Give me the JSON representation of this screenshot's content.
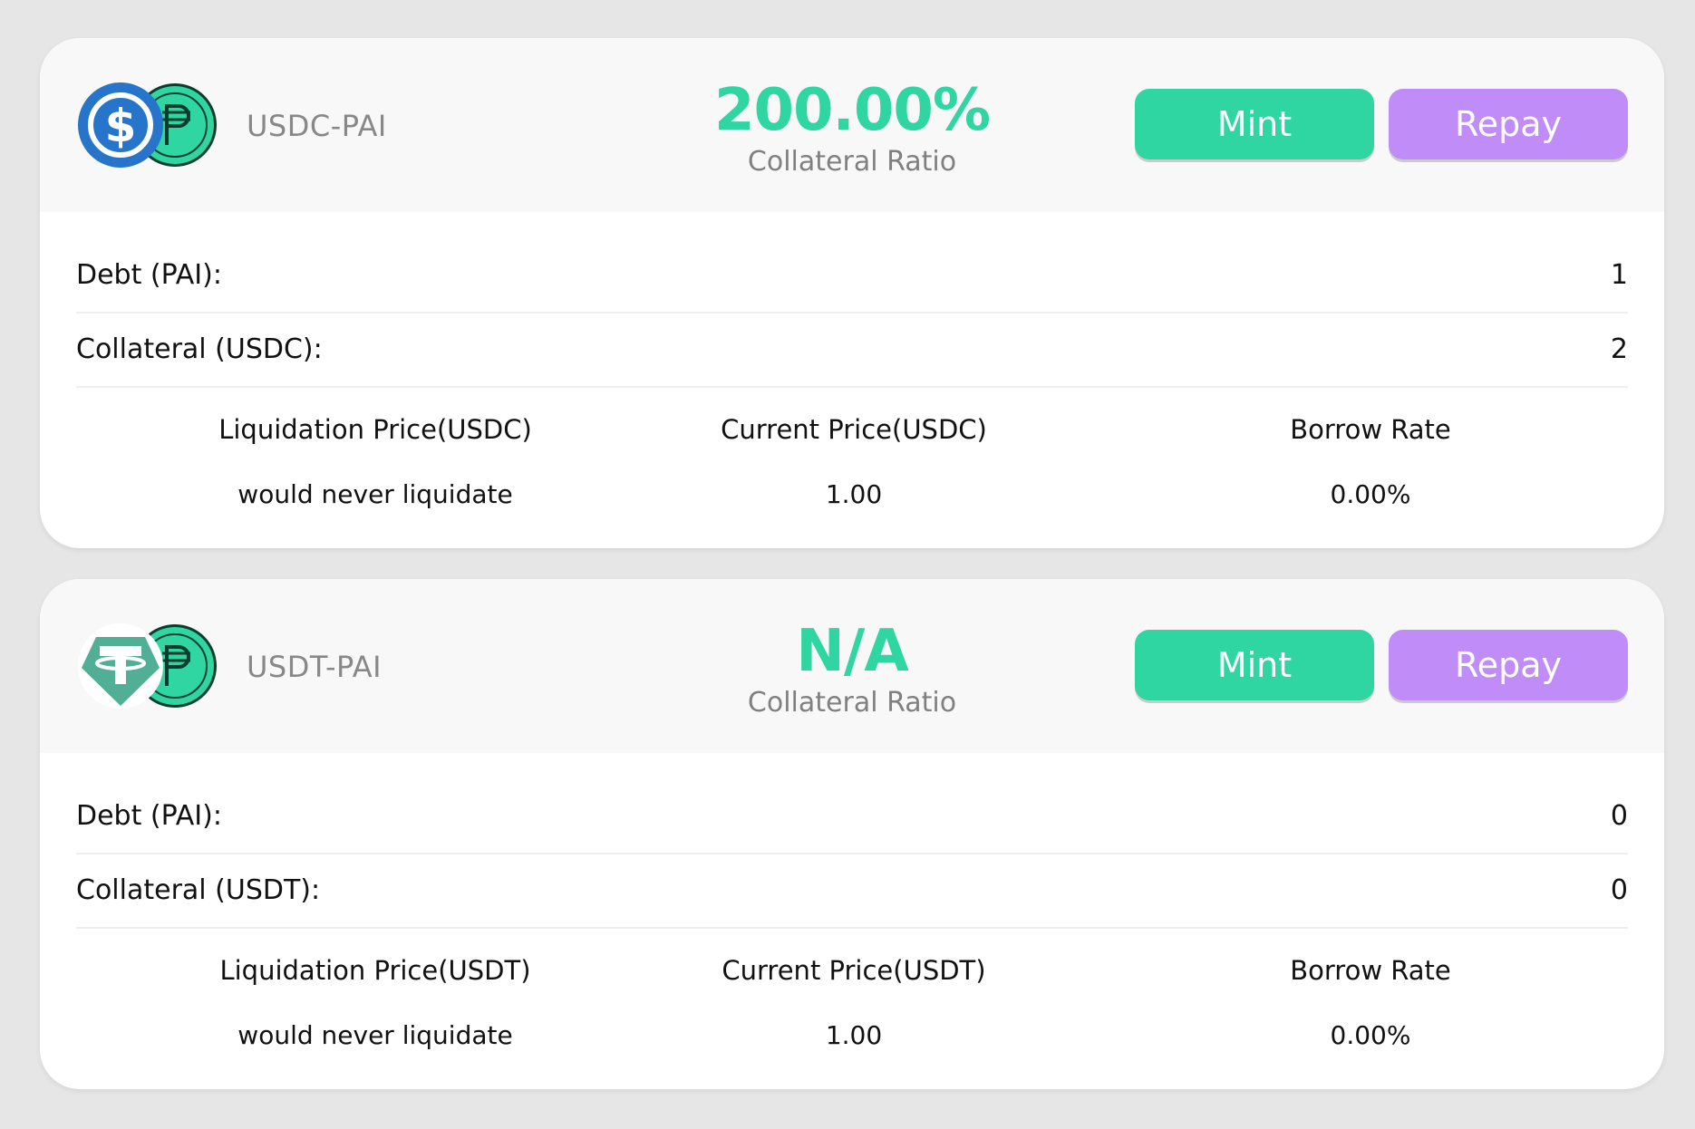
{
  "vaults": [
    {
      "pair": "USDC-PAI",
      "collateral_ratio": "200.00%",
      "collateral_ratio_label": "Collateral Ratio",
      "mint_label": "Mint",
      "repay_label": "Repay",
      "debt_label": "Debt (PAI):",
      "debt_value": "1",
      "collateral_label": "Collateral (USDC):",
      "collateral_value": "2",
      "liq_price_label": "Liquidation Price(USDC)",
      "liq_price_value": "would never liquidate",
      "current_price_label": "Current Price(USDC)",
      "current_price_value": "1.00",
      "borrow_rate_label": "Borrow Rate",
      "borrow_rate_value": "0.00%",
      "token_icon": "usdc-icon",
      "token_color": "#2775ca"
    },
    {
      "pair": "USDT-PAI",
      "collateral_ratio": "N/A",
      "collateral_ratio_label": "Collateral Ratio",
      "mint_label": "Mint",
      "repay_label": "Repay",
      "debt_label": "Debt (PAI):",
      "debt_value": "0",
      "collateral_label": "Collateral (USDT):",
      "collateral_value": "0",
      "liq_price_label": "Liquidation Price(USDT)",
      "liq_price_value": "would never liquidate",
      "current_price_label": "Current Price(USDT)",
      "current_price_value": "1.00",
      "borrow_rate_label": "Borrow Rate",
      "borrow_rate_value": "0.00%",
      "token_icon": "usdt-icon",
      "token_color": "#50af95"
    }
  ],
  "pai_icon": "pai-icon",
  "colors": {
    "accent_green": "#2fd6a2",
    "accent_purple": "#bf8cf8",
    "muted_text": "#888888"
  }
}
